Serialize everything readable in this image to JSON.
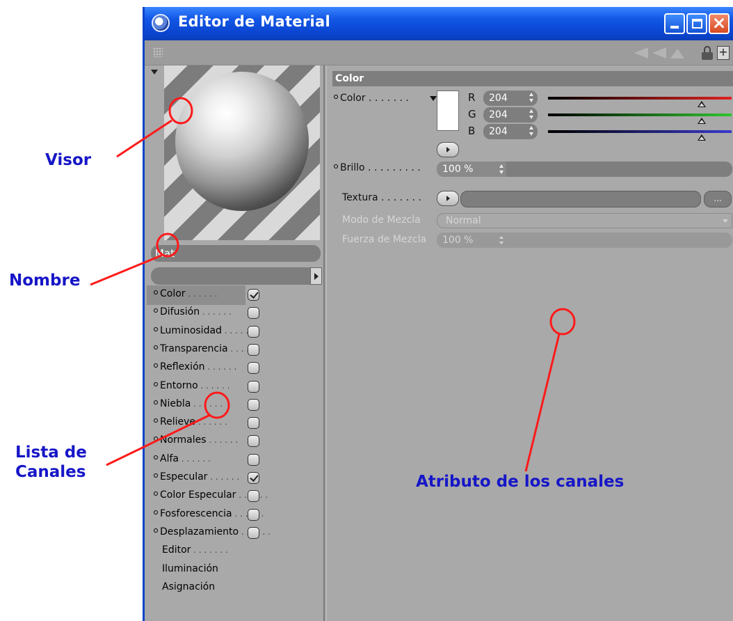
{
  "window": {
    "title": "Editor de Material",
    "accent_color": "#0a43c8",
    "controls": {
      "minimize": "minimize-icon",
      "maximize": "maximize-icon",
      "close": "close-icon"
    }
  },
  "toolbar": {
    "icons": [
      "grip-icon",
      "nav-arrows-icon",
      "lock-icon",
      "new-window-icon"
    ]
  },
  "material": {
    "name": "Mat",
    "channels": [
      {
        "label": "Color",
        "checked": true,
        "active": true
      },
      {
        "label": "Difusión",
        "checked": false
      },
      {
        "label": "Luminosidad",
        "checked": false
      },
      {
        "label": "Transparencia",
        "checked": false
      },
      {
        "label": "Reflexión",
        "checked": false
      },
      {
        "label": "Entorno",
        "checked": false
      },
      {
        "label": "Niebla",
        "checked": false
      },
      {
        "label": "Relieve",
        "checked": false
      },
      {
        "label": "Normales",
        "checked": false
      },
      {
        "label": "Alfa",
        "checked": false
      },
      {
        "label": "Especular",
        "checked": true
      },
      {
        "label": "Color Especular",
        "checked": false
      },
      {
        "label": "Fosforescencia",
        "checked": false
      },
      {
        "label": "Desplazamiento",
        "checked": false
      }
    ],
    "extra_items": [
      "Editor",
      "Iluminación",
      "Asignación"
    ]
  },
  "attributes": {
    "section_title": "Color",
    "color_label": "Color",
    "swatch_color": "#ffffff",
    "rgb": [
      {
        "letter": "R",
        "value": "204",
        "fraction": 0.8,
        "color": "#e02020"
      },
      {
        "letter": "G",
        "value": "204",
        "fraction": 0.8,
        "color": "#2ec52e"
      },
      {
        "letter": "B",
        "value": "204",
        "fraction": 0.8,
        "color": "#3a3acc"
      }
    ],
    "brightness_label": "Brillo",
    "brightness_value": "100 %",
    "texture_label": "Textura",
    "texture_more": "...",
    "blend_mode_label": "Modo de Mezcla",
    "blend_mode_value": "Normal",
    "blend_strength_label": "Fuerza de Mezcla",
    "blend_strength_value": "100 %"
  },
  "annotations": {
    "visor": "Visor",
    "nombre": "Nombre",
    "lista_line1": "Lista de",
    "lista_line2": "Canales",
    "atributo": "Atributo de los canales",
    "label_color": "#1616c8",
    "marker_color": "#ff1a1a"
  }
}
